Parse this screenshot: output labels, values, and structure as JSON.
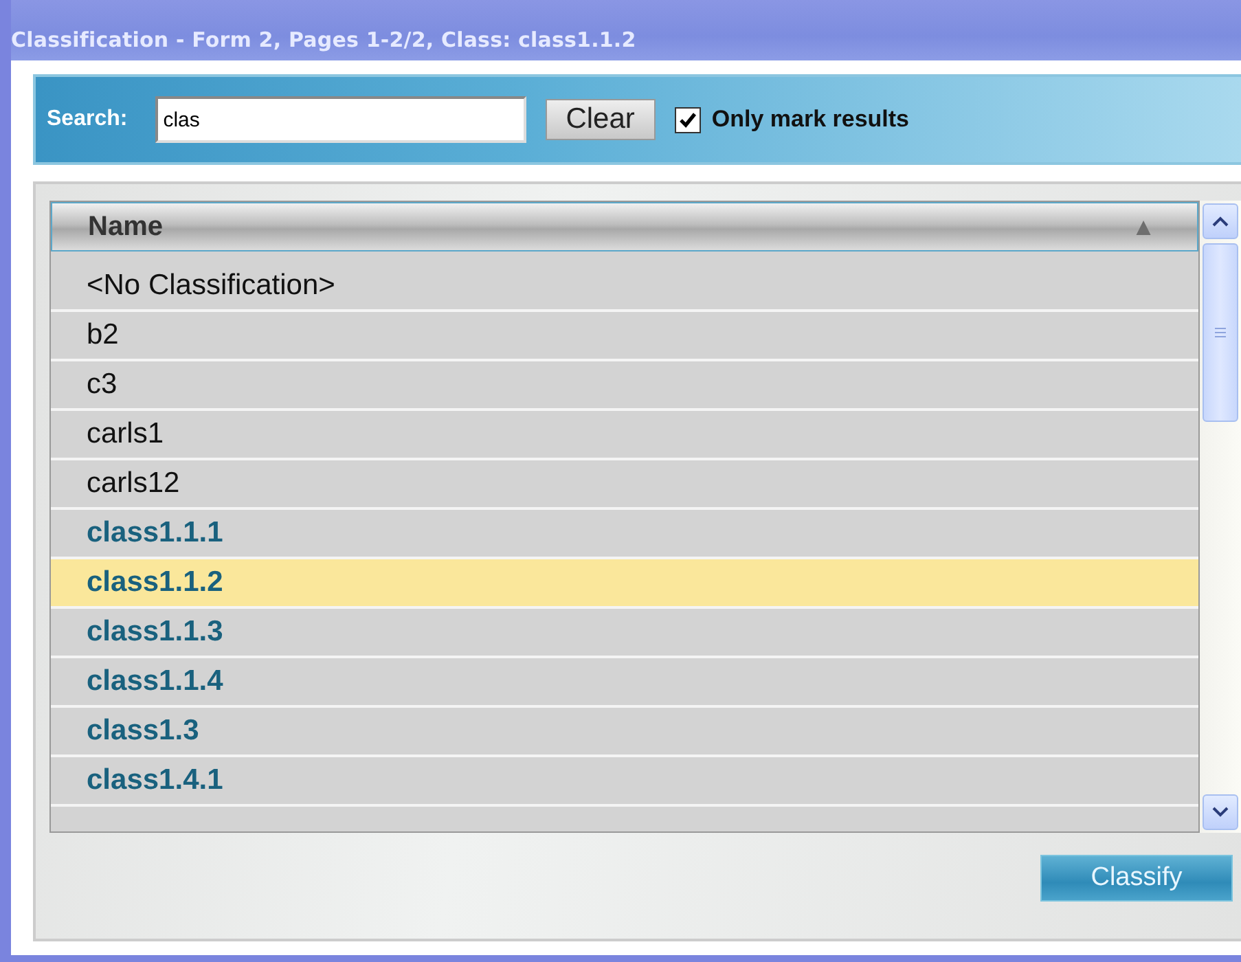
{
  "window": {
    "title": "Classification - Form 2, Pages 1-2/2, Class: class1.1.2"
  },
  "search": {
    "label": "Search:",
    "value": "clas",
    "clear_button": "Clear",
    "only_mark": {
      "label": "Only mark results",
      "checked": true
    }
  },
  "table": {
    "columns": [
      {
        "label": "Name",
        "sort_glyph": "▲"
      }
    ],
    "rows": [
      {
        "name": "<No Classification>",
        "matched": false,
        "selected": false
      },
      {
        "name": "b2",
        "matched": false,
        "selected": false
      },
      {
        "name": "c3",
        "matched": false,
        "selected": false
      },
      {
        "name": "carls1",
        "matched": false,
        "selected": false
      },
      {
        "name": "carls12",
        "matched": false,
        "selected": false
      },
      {
        "name": "class1.1.1",
        "matched": true,
        "selected": false
      },
      {
        "name": "class1.1.2",
        "matched": true,
        "selected": true
      },
      {
        "name": "class1.1.3",
        "matched": true,
        "selected": false
      },
      {
        "name": "class1.1.4",
        "matched": true,
        "selected": false
      },
      {
        "name": "class1.3",
        "matched": true,
        "selected": false
      },
      {
        "name": "class1.4.1",
        "matched": true,
        "selected": false
      }
    ]
  },
  "buttons": {
    "classify": "Classify"
  }
}
